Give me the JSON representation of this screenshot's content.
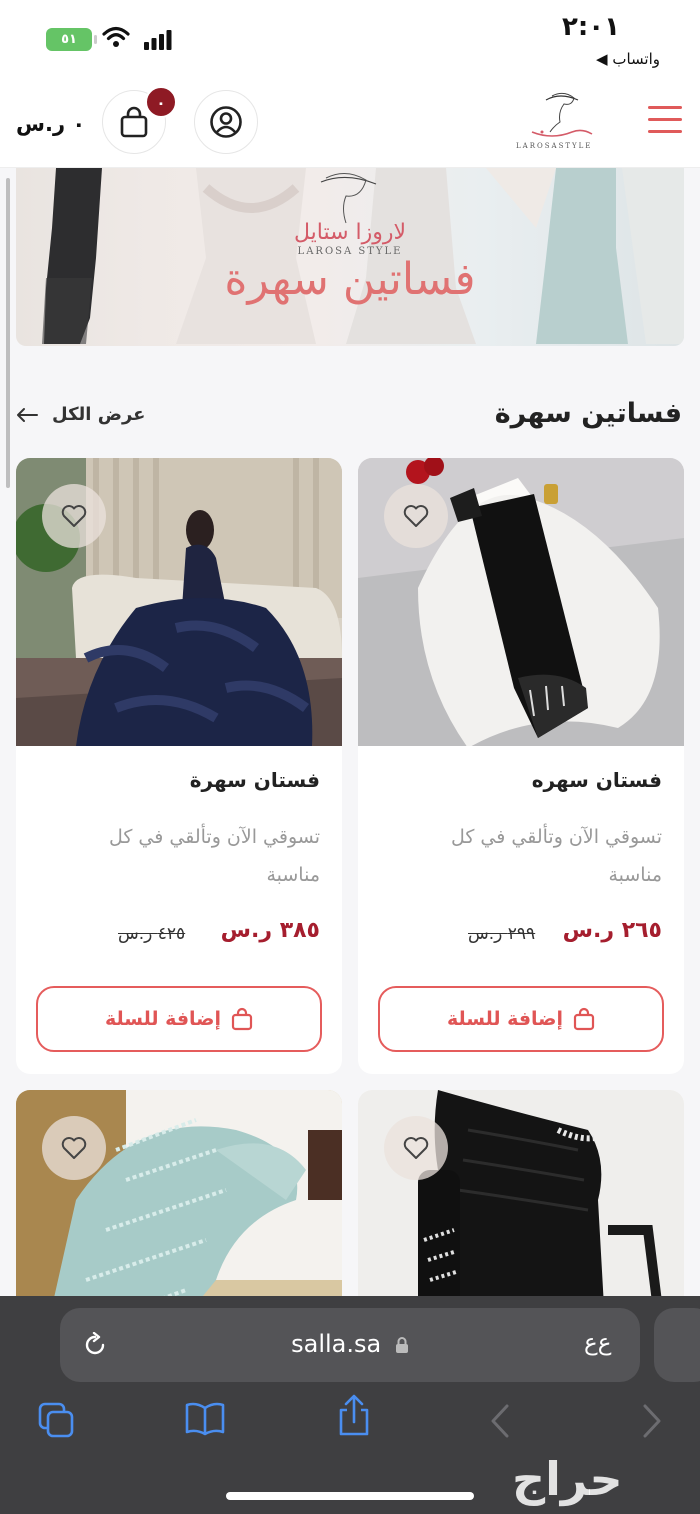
{
  "status_bar": {
    "time": "٢:٠١",
    "back_app": "◀ واتساب",
    "battery": "٥١"
  },
  "header": {
    "cart_count": "٠",
    "cart_total": "٠ ر.س",
    "logo_text": "LAROSASTYLE"
  },
  "banner": {
    "brand_ar": "لاروزا ستايل",
    "brand_en": "LAROSA STYLE",
    "title": "فساتين سهرة"
  },
  "section": {
    "title": "فساتين سهرة",
    "view_all": "عرض الكل"
  },
  "products": [
    {
      "name": "فستان سهره",
      "description": "تسوقي الآن وتألقي في كل مناسبة",
      "price": "٢٦٥ ر.س",
      "old_price": "٢٩٩ ر.س",
      "add_label": "إضافة للسلة"
    },
    {
      "name": "فستان سهرة",
      "description": "تسوقي الآن وتألقي في كل مناسبة",
      "price": "٣٨٥ ر.س",
      "old_price": "٤٢٥ ر.س",
      "add_label": "إضافة للسلة"
    }
  ],
  "browser": {
    "url": "salla.sa",
    "aa": "ﻉﻉ",
    "watermark": "حراج"
  }
}
